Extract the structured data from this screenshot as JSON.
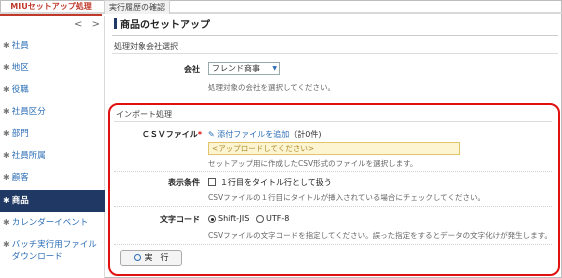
{
  "tabs": [
    "MIUセットアップ処理",
    "実行履歴の確認"
  ],
  "nav_arrows": {
    "prev": "<",
    "next": ">"
  },
  "sidebar": {
    "items": [
      {
        "label": "社員"
      },
      {
        "label": "地区"
      },
      {
        "label": "役職"
      },
      {
        "label": "社員区分"
      },
      {
        "label": "部門"
      },
      {
        "label": "社員所属"
      },
      {
        "label": "顧客"
      },
      {
        "label": "商品",
        "active": true
      },
      {
        "label": "カレンダーイベント"
      },
      {
        "label": "バッチ実行用ファイルダウンロード",
        "line1": "バッチ実行用ファイル",
        "line2": "ダウンロード"
      }
    ]
  },
  "page_title": "商品のセットアップ",
  "company_section": {
    "heading": "処理対象会社選択",
    "company_label": "会社",
    "company_value": "フレンド商事",
    "company_hint": "処理対象の会社を選択してください。"
  },
  "import_section": {
    "heading": "インポート処理",
    "csv_label": "ＣＳＶファイル",
    "required_mark": "*",
    "attach_link": "添付ファイルを追加",
    "attach_count": "（計0件)",
    "dropzone_placeholder": "<アップロードしてください>",
    "csv_hint": "セットアップ用に作成したCSV形式のファイルを選択します。",
    "display_label": "表示条件",
    "title_row_option": "１行目をタイトル行として扱う",
    "title_row_hint": "CSVファイルの１行目にタイトルが挿入されている場合にチェックしてください。",
    "encoding_label": "文字コード",
    "encoding_options": [
      "Shift-JIS",
      "UTF-8"
    ],
    "encoding_selected": "Shift-JIS",
    "encoding_hint": "CSVファイルの文字コードを指定してください。誤った指定をするとデータの文字化けが発生します。",
    "execute_button": "実　行"
  }
}
